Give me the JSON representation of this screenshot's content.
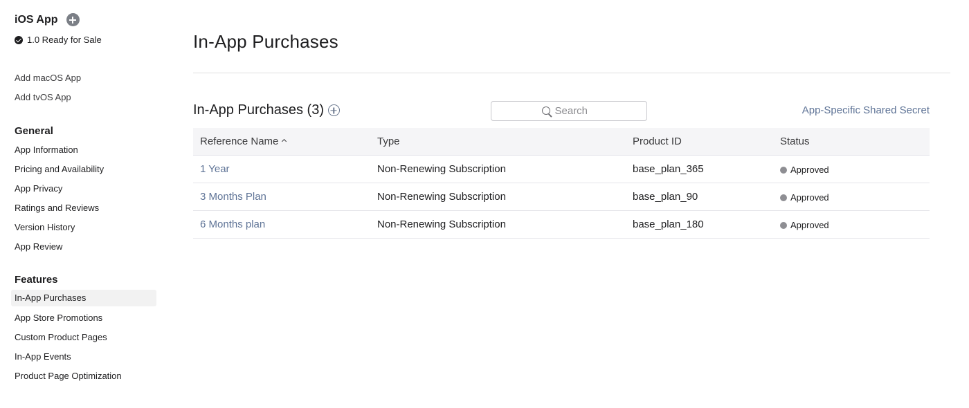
{
  "sidebar": {
    "app_title": "iOS App",
    "version_status": "1.0 Ready for Sale",
    "add_platform_links": [
      "Add macOS App",
      "Add tvOS App"
    ],
    "general": {
      "heading": "General",
      "items": [
        "App Information",
        "Pricing and Availability",
        "App Privacy",
        "Ratings and Reviews",
        "Version History",
        "App Review"
      ]
    },
    "features": {
      "heading": "Features",
      "selected": "In-App Purchases",
      "items": [
        "In-App Purchases",
        "App Store Promotions",
        "Custom Product Pages",
        "In-App Events",
        "Product Page Optimization"
      ]
    }
  },
  "main": {
    "page_title": "In-App Purchases",
    "section_title": "In-App Purchases (3)",
    "search": {
      "placeholder": "Search",
      "value": ""
    },
    "shared_secret_link": "App-Specific Shared Secret",
    "table": {
      "columns": [
        "Reference Name",
        "Type",
        "Product ID",
        "Status"
      ],
      "sort": {
        "column": "Reference Name",
        "direction": "ascending"
      },
      "rows": [
        {
          "name": "1 Year",
          "type": "Non-Renewing Subscription",
          "product_id": "base_plan_365",
          "status": "Approved"
        },
        {
          "name": "3 Months Plan",
          "type": "Non-Renewing Subscription",
          "product_id": "base_plan_90",
          "status": "Approved"
        },
        {
          "name": "6 Months plan",
          "type": "Non-Renewing Subscription",
          "product_id": "base_plan_180",
          "status": "Approved"
        }
      ]
    }
  },
  "colors": {
    "link": "#5e7396",
    "text": "#1d1d1f",
    "status_dot": "#8e8e93",
    "header_bg": "#f5f5f7",
    "selected_bg": "#f2f2f2"
  },
  "icons": {
    "add_platform": "plus-circle-filled-icon",
    "status_check": "checkmark-circle-icon",
    "add_iap": "plus-circle-outline-icon",
    "search": "magnifier-icon",
    "sort": "chevron-up-icon",
    "status": "dot-icon"
  }
}
